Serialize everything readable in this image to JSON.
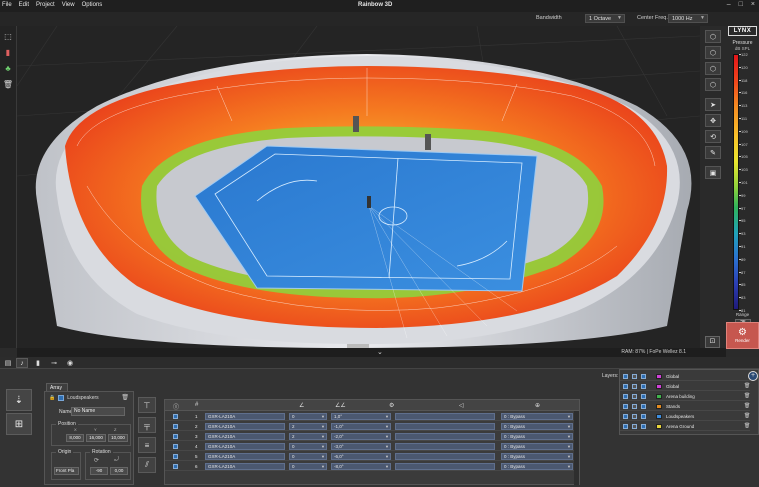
{
  "app": {
    "title": "Rainbow 3D",
    "menu": [
      "File",
      "Edit",
      "Project",
      "View",
      "Options"
    ],
    "window_controls": [
      "–",
      "□",
      "×"
    ]
  },
  "toolbar": {
    "bandwidth_label": "Bandwidth",
    "bandwidth_value": "1 Octave",
    "center_freq_label": "Center Freq.",
    "center_freq_value": "1000 Hz"
  },
  "left_tools": [
    "cube-add-icon",
    "speaker-icon",
    "audience-icon",
    "trash-icon"
  ],
  "right_tools": [
    "view-iso-icon",
    "view-front-icon",
    "view-side-icon",
    "view-top-icon",
    "pointer-icon",
    "move-icon",
    "orbit-icon",
    "measure-icon",
    "camera-icon"
  ],
  "legend": {
    "logo": "LYNX",
    "title": "Pressure",
    "unit": "dB SPL",
    "top_value": "122",
    "ticks": [
      "122",
      "120",
      "118",
      "116",
      "113",
      "111",
      "109",
      "107",
      "105",
      "103",
      "101",
      "99",
      "97",
      "95",
      "93",
      "91",
      "89",
      "87",
      "85",
      "83",
      "81"
    ],
    "range_label": "Range",
    "range_value": "25",
    "color_step_label": "Color Step",
    "color_step_value": "None",
    "colors": {
      "max": "#e3151a",
      "mid": "#e9e52f",
      "min": "#1f1a7a"
    }
  },
  "render_button": {
    "label": "Render"
  },
  "status": {
    "text": "RAM: 87%  |  FoPe Wellez 8.1"
  },
  "bottom_tabs": [
    "layers-icon",
    "speaker-array-icon",
    "receiver-icon",
    "mic-icon",
    "settings-icon"
  ],
  "array": {
    "tab_label": "Array 1",
    "item_label": "Loudspeakers",
    "name_label": "Name",
    "name_value": "No Name",
    "position_title": "Position",
    "position_axes": [
      "X",
      "Y",
      "Z"
    ],
    "position_values": [
      "8,000",
      "16,000",
      "10,000"
    ],
    "origin_title": "Origin",
    "origin_value": "Front Pla",
    "rotation_title": "Rotation",
    "rotation_values": [
      "-90",
      "0,00"
    ]
  },
  "table": {
    "headers": [
      "Ⓘ",
      "#",
      "∠",
      "∠∠",
      "⚙",
      "◁",
      "⊕"
    ],
    "rows": [
      {
        "num": "1",
        "model": "GXR-LA210A",
        "count": "0",
        "angle": "1,0°",
        "mode": "0 : Bypass"
      },
      {
        "num": "2",
        "model": "GXR-LA210A",
        "count": "2",
        "angle": "-1,0°",
        "mode": "0 : Bypass"
      },
      {
        "num": "3",
        "model": "GXR-LA210A",
        "count": "2",
        "angle": "-2,0°",
        "mode": "0 : Bypass"
      },
      {
        "num": "4",
        "model": "GXR-LA210A",
        "count": "0",
        "angle": "-3,0°",
        "mode": "0 : Bypass"
      },
      {
        "num": "5",
        "model": "GXR-LA210A",
        "count": "0",
        "angle": "-6,0°",
        "mode": "0 : Bypass"
      },
      {
        "num": "6",
        "model": "GXR-LA210A",
        "count": "0",
        "angle": "-8,0°",
        "mode": "0 : Bypass"
      }
    ]
  },
  "layers": {
    "label": "Layers:",
    "items": [
      {
        "name": "Global",
        "color": "#d13fd8"
      },
      {
        "name": "Global",
        "color": "#d13fd8"
      },
      {
        "name": "Arena building",
        "color": "#3fb54b"
      },
      {
        "name": "Stands",
        "color": "#e28a1f"
      },
      {
        "name": "Loudspeakers",
        "color": "#3b8de0"
      },
      {
        "name": "Arena Ground",
        "color": "#e9d43a"
      }
    ]
  }
}
